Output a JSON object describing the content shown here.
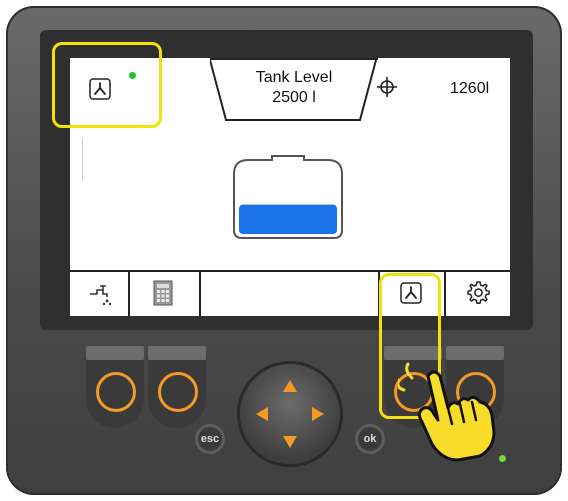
{
  "header": {
    "title": "Tank Level",
    "value": "2500 l",
    "volume": "1260l"
  },
  "status": {
    "indicator_color": "#21c32b"
  },
  "tank": {
    "fill_fraction": 0.42,
    "fill_color": "#1a73e8"
  },
  "softkeys": [
    "tap-water-icon",
    "calculator-icon",
    "lower-icon",
    "gear-icon"
  ],
  "hardware": {
    "esc_label": "esc",
    "ok_label": "ok",
    "accent": "#f59a25",
    "led_color": "#7ed63a"
  },
  "highlight": {
    "color": "#f2e20a"
  }
}
